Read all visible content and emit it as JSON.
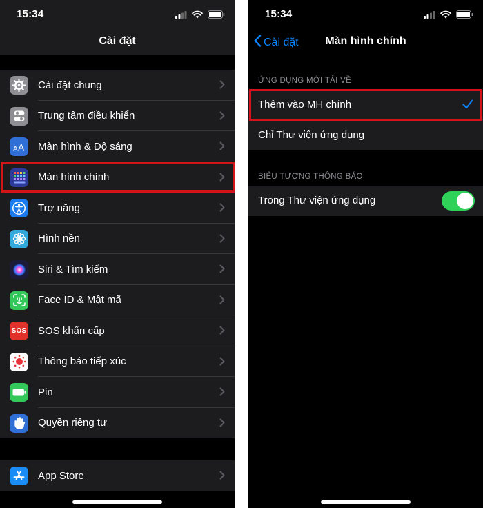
{
  "left": {
    "status": {
      "time": "15:34"
    },
    "title": "Cài đặt",
    "items": [
      {
        "label": "Cài đặt chung",
        "icon": "gear-icon",
        "color": "#8e8e93"
      },
      {
        "label": "Trung tâm điều khiển",
        "icon": "control-center-icon",
        "color": "#8e8e93"
      },
      {
        "label": "Màn hình & Độ sáng",
        "icon": "display-brightness-icon",
        "color": "#2f6fd6"
      },
      {
        "label": "Màn hình chính",
        "icon": "home-screen-icon",
        "color": "#2c3a9c"
      },
      {
        "label": "Trợ năng",
        "icon": "accessibility-icon",
        "color": "#1a7cf0"
      },
      {
        "label": "Hình nền",
        "icon": "wallpaper-icon",
        "color": "#34aadc"
      },
      {
        "label": "Siri & Tìm kiếm",
        "icon": "siri-icon",
        "color": "#1c1c3a"
      },
      {
        "label": "Face ID & Mật mã",
        "icon": "face-id-icon",
        "color": "#34c759"
      },
      {
        "label": "SOS khẩn cấp",
        "icon": "sos-icon",
        "color": "#e0312a",
        "icon_text": "SOS"
      },
      {
        "label": "Thông báo tiếp xúc",
        "icon": "exposure-notification-icon",
        "color": "#ffffff"
      },
      {
        "label": "Pin",
        "icon": "battery-icon",
        "color": "#34c759"
      },
      {
        "label": "Quyền riêng tư",
        "icon": "privacy-hand-icon",
        "color": "#2f6fd6"
      }
    ],
    "bottom_item": {
      "label": "App Store",
      "icon": "app-store-icon",
      "color": "#1a8cf5"
    }
  },
  "right": {
    "status": {
      "time": "15:34"
    },
    "back_label": "Cài đặt",
    "title": "Màn hình chính",
    "section1": {
      "header": "ỨNG DỤNG MỚI TẢI VỀ",
      "options": [
        {
          "label": "Thêm vào MH chính",
          "selected": true
        },
        {
          "label": "Chỉ Thư viện ứng dụng",
          "selected": false
        }
      ]
    },
    "section2": {
      "header": "BIỂU TƯỢNG THÔNG BÁO",
      "toggle_label": "Trong Thư viện ứng dụng",
      "toggle_on": true
    }
  },
  "colors": {
    "accent": "#0a84ff",
    "highlight": "#d3141b",
    "toggle_on": "#30d158"
  }
}
